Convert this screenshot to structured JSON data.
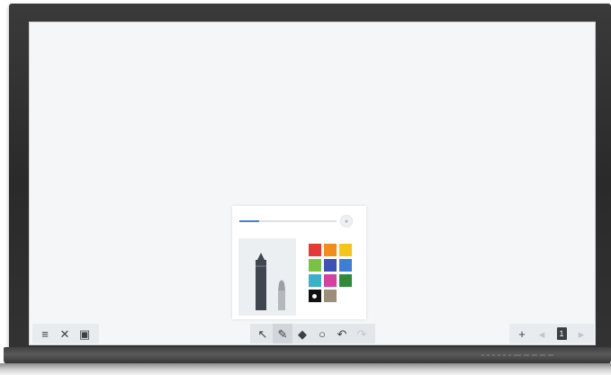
{
  "left_toolbar": {
    "items": [
      {
        "icon": "menu-icon",
        "glyph": "≡"
      },
      {
        "icon": "close-icon",
        "glyph": "✕"
      },
      {
        "icon": "image-icon",
        "glyph": "▣"
      }
    ]
  },
  "center_toolbar": {
    "items": [
      {
        "icon": "select-arrow-icon",
        "glyph": "↖",
        "active": false
      },
      {
        "icon": "pen-icon",
        "glyph": "✎",
        "active": true
      },
      {
        "icon": "eraser-icon",
        "glyph": "◆",
        "active": false
      },
      {
        "icon": "circle-shape-icon",
        "glyph": "○",
        "active": false
      },
      {
        "icon": "undo-icon",
        "glyph": "↶",
        "active": false
      },
      {
        "icon": "redo-icon",
        "glyph": "↷",
        "active": false,
        "disabled": true
      }
    ]
  },
  "right_toolbar": {
    "items": [
      {
        "icon": "add-page-icon",
        "glyph": "+"
      },
      {
        "icon": "previous-page-icon",
        "glyph": "◂",
        "disabled": true
      },
      {
        "icon": "page-indicator-icon",
        "glyph": "1"
      },
      {
        "icon": "next-page-icon",
        "glyph": "▸",
        "disabled": true
      }
    ]
  },
  "pen_panel": {
    "thickness_fraction": 0.2,
    "selected_tool": "pen",
    "colors": [
      "#e53935",
      "#f28c1b",
      "#f5c518",
      "#7cc242",
      "#3f51b5",
      "#3d7fd6",
      "#3ab0c9",
      "#d6409f",
      "#2e8b3a",
      "#111111",
      "#9c8f7a"
    ],
    "selected_color": "#111111",
    "accent_color": "#4a7fc1"
  }
}
